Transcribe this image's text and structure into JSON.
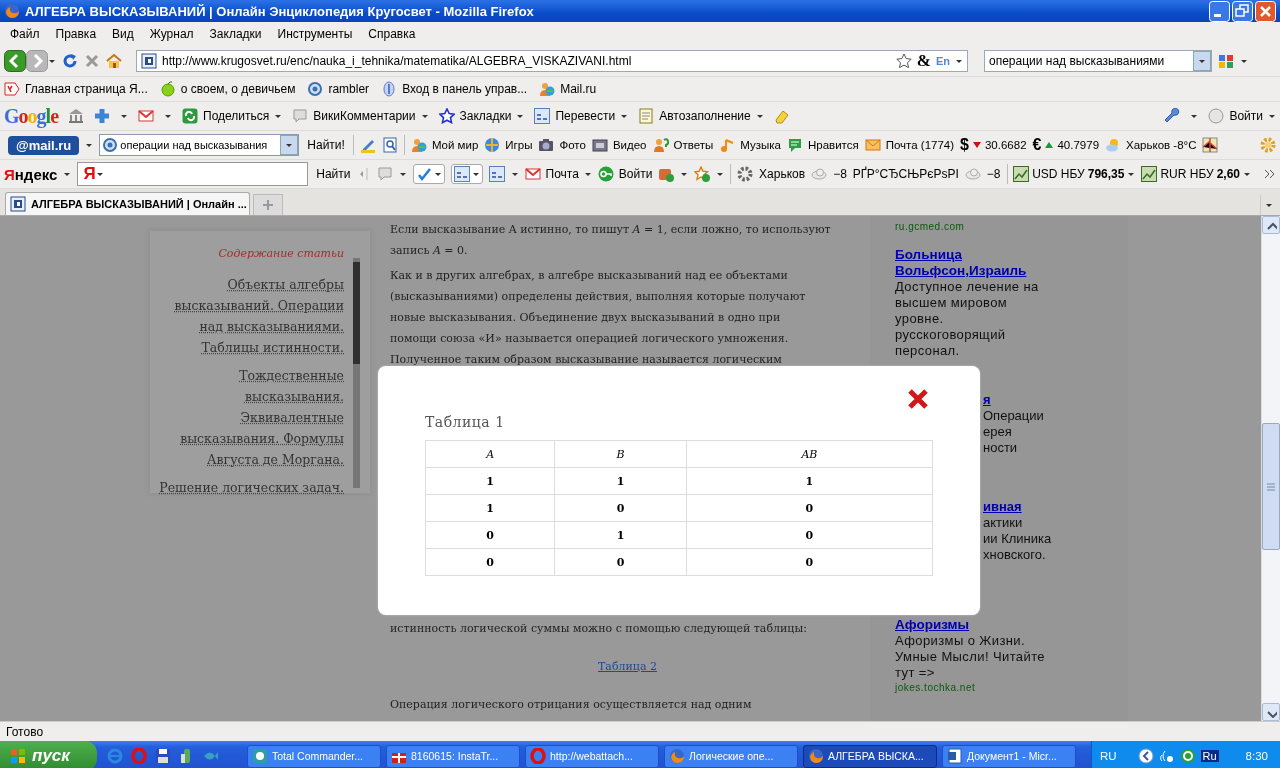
{
  "window": {
    "title": "АЛГЕБРА ВЫСКАЗЫВАНИЙ | Онлайн Энциклопедия Кругосвет - Mozilla Firefox"
  },
  "menu": [
    {
      "label": "Файл"
    },
    {
      "label": "Правка"
    },
    {
      "label": "Вид"
    },
    {
      "label": "Журнал"
    },
    {
      "label": "Закладки"
    },
    {
      "label": "Инструменты"
    },
    {
      "label": "Справка"
    }
  ],
  "navigation": {
    "url": "http://www.krugosvet.ru/enc/nauka_i_tehnika/matematika/ALGEBRA_VISKAZIVANI.html",
    "amp_button": "&",
    "lang_button": "En",
    "search_value": "операции над высказываниями"
  },
  "bookmarks": [
    {
      "label": "Главная страница Я..."
    },
    {
      "label": "о своем, о девичьем"
    },
    {
      "label": "rambler"
    },
    {
      "label": "Вход в панель управ..."
    },
    {
      "label": "Mail.ru"
    }
  ],
  "google_toolbar": {
    "logo": "Google",
    "items": [
      {
        "label": "Поделиться"
      },
      {
        "label": "ВикиКомментарии"
      },
      {
        "label": "Закладки"
      },
      {
        "label": "Перевести"
      },
      {
        "label": "Автозаполнение"
      }
    ],
    "sign_in": "Войти"
  },
  "mailru_toolbar": {
    "logo": "@mail.ru",
    "search_value": "операции над высказывания",
    "search_button": "Найти!",
    "items": [
      {
        "label": "Мой мир"
      },
      {
        "label": "Игры"
      },
      {
        "label": "Фото"
      },
      {
        "label": "Видео"
      },
      {
        "label": "Ответы"
      },
      {
        "label": "Музыка"
      },
      {
        "label": "Нравится"
      },
      {
        "label": "Почта (1774)"
      }
    ],
    "rates": [
      {
        "symbol": "$",
        "value": "30.6682",
        "rising": false
      },
      {
        "symbol": "€",
        "value": "40.7979",
        "rising": true
      }
    ],
    "weather": "Харьков -8°C"
  },
  "yandex_toolbar": {
    "logo": "Яндекс",
    "search_mark": "Я",
    "search_button": "Найти",
    "items": [
      {
        "label": "Почта"
      },
      {
        "label": "Войти"
      }
    ],
    "city": "Харьков",
    "temp_1": "−8",
    "garbled_label": "РҐР°СЂСЊРєРѕРІ",
    "temp_2": "−8",
    "rates": [
      {
        "label": "USD НБУ",
        "value": "796,35"
      },
      {
        "label": "RUR НБУ",
        "value": "2,60"
      }
    ]
  },
  "tabs": [
    {
      "title": "АЛГЕБРА ВЫСКАЗЫВАНИЙ | Онлайн ...",
      "selected": true
    }
  ],
  "toc": {
    "title": "Содержание статьи",
    "links": [
      "Объекты алгебры\nвысказываний. Операции\nнад высказываниями.\nТаблицы истинности.",
      "Тождественные\nвысказывания.\nЭквивалентные\nвысказывания. Формулы\nАвгуста де Моргана.",
      "Решение логических задач."
    ]
  },
  "article": {
    "paragraphs": [
      "Если высказывание A истинно, то пишут *A* = 1, если ложно, то используют\nзапись *A* = 0.",
      "Как и в других алгебрах, в алгебре высказываний над ее объектами\n(высказываниями) определены действия, выполняя которые получают\nновые высказывания. Объединение двух высказываний в одно при\nпомощи союза «И» называется операцией логического умножения.\nПолученное таким образом высказывание называется логическим"
    ],
    "after_text": "истинность логической суммы можно с помощью следующей таблицы:",
    "table_link": "Таблица 2",
    "last_text": "Операция логического отрицания осуществляется над одним"
  },
  "ads": {
    "top_domain": "ru.gcmed.com",
    "first": {
      "title": "Больница\nВольфсон,Израиль",
      "text": "Доступное лечение на\nвысшем мировом\nуровне.\nрусскоговорящий\nперсонал."
    },
    "fragments_1": [
      {
        "kind": "link",
        "text": "я"
      },
      {
        "kind": "text",
        "text": "Операции"
      },
      {
        "kind": "text",
        "text": "ерея"
      },
      {
        "kind": "text",
        "text": "ности"
      }
    ],
    "fragments_2": [
      {
        "kind": "link",
        "text": "ивная"
      },
      {
        "kind": "text",
        "text": "актики"
      },
      {
        "kind": "text",
        "text": "ии Клиника"
      },
      {
        "kind": "text",
        "text": "хновского."
      }
    ],
    "last": {
      "title": "Афоризмы",
      "text": "Афоризмы о Жизни.\nУмные Мысли! Читайте\nтут =>",
      "domain": "jokes.tochka.net"
    }
  },
  "modal": {
    "title": "Таблица 1",
    "columns": [
      "A",
      "B",
      "AB"
    ],
    "rows": [
      [
        "1",
        "1",
        "1"
      ],
      [
        "1",
        "0",
        "0"
      ],
      [
        "0",
        "1",
        "0"
      ],
      [
        "0",
        "0",
        "0"
      ]
    ]
  },
  "status_bar": "Готово",
  "taskbar": {
    "start": "пуск",
    "tasks": [
      {
        "label": "Total Commander...",
        "selected": false
      },
      {
        "label": "8160615: InstaTr...",
        "selected": false
      },
      {
        "label": "http://webattach...",
        "selected": false
      },
      {
        "label": "Логические опе...",
        "selected": false
      },
      {
        "label": "АЛГЕБРА ВЫСКА...",
        "selected": true
      },
      {
        "label": "Документ1 - Micr...",
        "selected": false
      }
    ],
    "language": "RU",
    "tray_badge": "Ru",
    "clock": "8:30"
  }
}
